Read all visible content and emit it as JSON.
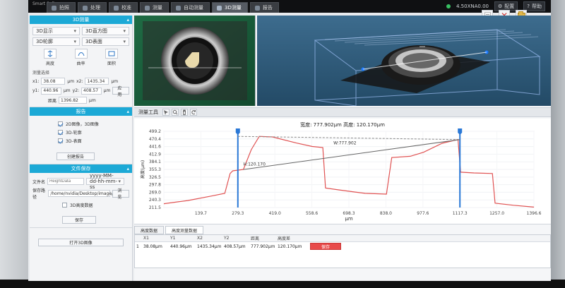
{
  "app": {
    "title": "Smart Software",
    "tabs": [
      {
        "label": "拍照",
        "active": false
      },
      {
        "label": "处理",
        "active": false
      },
      {
        "label": "校准",
        "active": false
      },
      {
        "label": "测量",
        "active": false
      },
      {
        "label": "自动测量",
        "active": false
      },
      {
        "label": "3D测量",
        "active": true
      },
      {
        "label": "报告",
        "active": false
      }
    ],
    "top_right": {
      "lens": "4.50XNA0.00",
      "config_label": "配置",
      "help_label": "帮助"
    }
  },
  "left_panel": {
    "section_3d_measure": "3D测量",
    "dropdowns": [
      {
        "label": "3D显示"
      },
      {
        "label": "3D直方图"
      },
      {
        "label": "3D轮廓"
      },
      {
        "label": "3D表面"
      }
    ],
    "tools": [
      {
        "label": "高度",
        "icon": "height-icon"
      },
      {
        "label": "曲率",
        "icon": "curvature-icon"
      },
      {
        "label": "面积",
        "icon": "area-icon"
      }
    ],
    "measure_section_label": "测量选择",
    "coords": {
      "x1": "38.08",
      "y1": "440.96",
      "x2": "1435.34",
      "y2": "408.57",
      "unit": "μm",
      "apply": "应用"
    },
    "distance_label": "距离",
    "distance_value": "1396.82",
    "distance_unit": "μm",
    "report_section": "报告",
    "report_options": [
      {
        "label": "2D图像，3D图像",
        "checked": true
      },
      {
        "label": "3D-轮廓",
        "checked": true
      },
      {
        "label": "3D-表面",
        "checked": true
      }
    ],
    "create_report": "创建报告",
    "file_section": "文件保存",
    "file_name_label": "文件名",
    "file_name_placeholder": "HeightData",
    "file_name_suffix": "yyyy-MM-dd-hh-mm-ss",
    "save_path_label": "保存路径",
    "save_path_value": "/home/nvidia/Desktop/image/3D",
    "browse": "浏览",
    "save_3d_data": "3D高度数据",
    "save": "保存",
    "open_3d": "打开3D图像"
  },
  "measure_tools": {
    "title": "测量工具"
  },
  "chart_data": {
    "type": "line",
    "title": "宽度: 777.902μm  高度: 120.170μm",
    "xlabel": "μm",
    "ylabel": "高度(μm)",
    "xlim": [
      0,
      1396.6
    ],
    "ylim": [
      211.5,
      499.2
    ],
    "x_ticks": [
      0,
      139.7,
      279.3,
      419.0,
      558.6,
      698.3,
      838.0,
      977.6,
      1117.3,
      1257.0,
      1396.6
    ],
    "x_tick_labels": [
      "",
      "139.7",
      "279.3",
      "419.0",
      "558.6",
      "698.3",
      "838.0",
      "977.6",
      "1117.3",
      "1257.0",
      "1396.6"
    ],
    "y_ticks": [
      211.5,
      240.3,
      269.0,
      297.8,
      326.5,
      355.3,
      384.1,
      412.9,
      441.6,
      470.4,
      499.2
    ],
    "y_tick_labels": [
      "211.5",
      "240.3",
      "269.0",
      "297.8",
      "326.5",
      "355.3",
      "384.1",
      "412.9",
      "441.6",
      "470.4",
      "499.2"
    ],
    "series": [
      {
        "values": [
          [
            0,
            226
          ],
          [
            90,
            238
          ],
          [
            180,
            255
          ],
          [
            230,
            265
          ],
          [
            250,
            340
          ],
          [
            260,
            350
          ],
          [
            300,
            355
          ],
          [
            330,
            430
          ],
          [
            360,
            480
          ],
          [
            410,
            478
          ],
          [
            500,
            455
          ],
          [
            560,
            442
          ],
          [
            600,
            438
          ],
          [
            610,
            285
          ],
          [
            660,
            278
          ],
          [
            720,
            270
          ],
          [
            760,
            265
          ],
          [
            840,
            262
          ],
          [
            860,
            400
          ],
          [
            930,
            405
          ],
          [
            980,
            420
          ],
          [
            1050,
            454
          ],
          [
            1110,
            468
          ],
          [
            1120,
            345
          ],
          [
            1170,
            342
          ],
          [
            1240,
            340
          ],
          [
            1250,
            228
          ],
          [
            1320,
            220
          ],
          [
            1396.6,
            213
          ]
        ]
      }
    ],
    "markers": [
      {
        "x": 279.3,
        "label": ""
      },
      {
        "x": 1117.3,
        "label": ""
      }
    ],
    "annotations": [
      {
        "text": "H:120.170",
        "x": 300,
        "y": 370
      },
      {
        "text": "W:777.902",
        "x": 640,
        "y": 450
      }
    ]
  },
  "table": {
    "tabs": [
      "高度数据",
      "高度测量数据"
    ],
    "headers": [
      "X1",
      "Y1",
      "X2",
      "Y2",
      "距离",
      "高度差"
    ],
    "row": {
      "idx": "1",
      "x1": "38.08μm",
      "y1": "440.96μm",
      "x2": "1435.34μm",
      "y2": "408.57μm",
      "distance": "777.902μm",
      "height_diff": "120.170μm",
      "save": "保存"
    }
  }
}
